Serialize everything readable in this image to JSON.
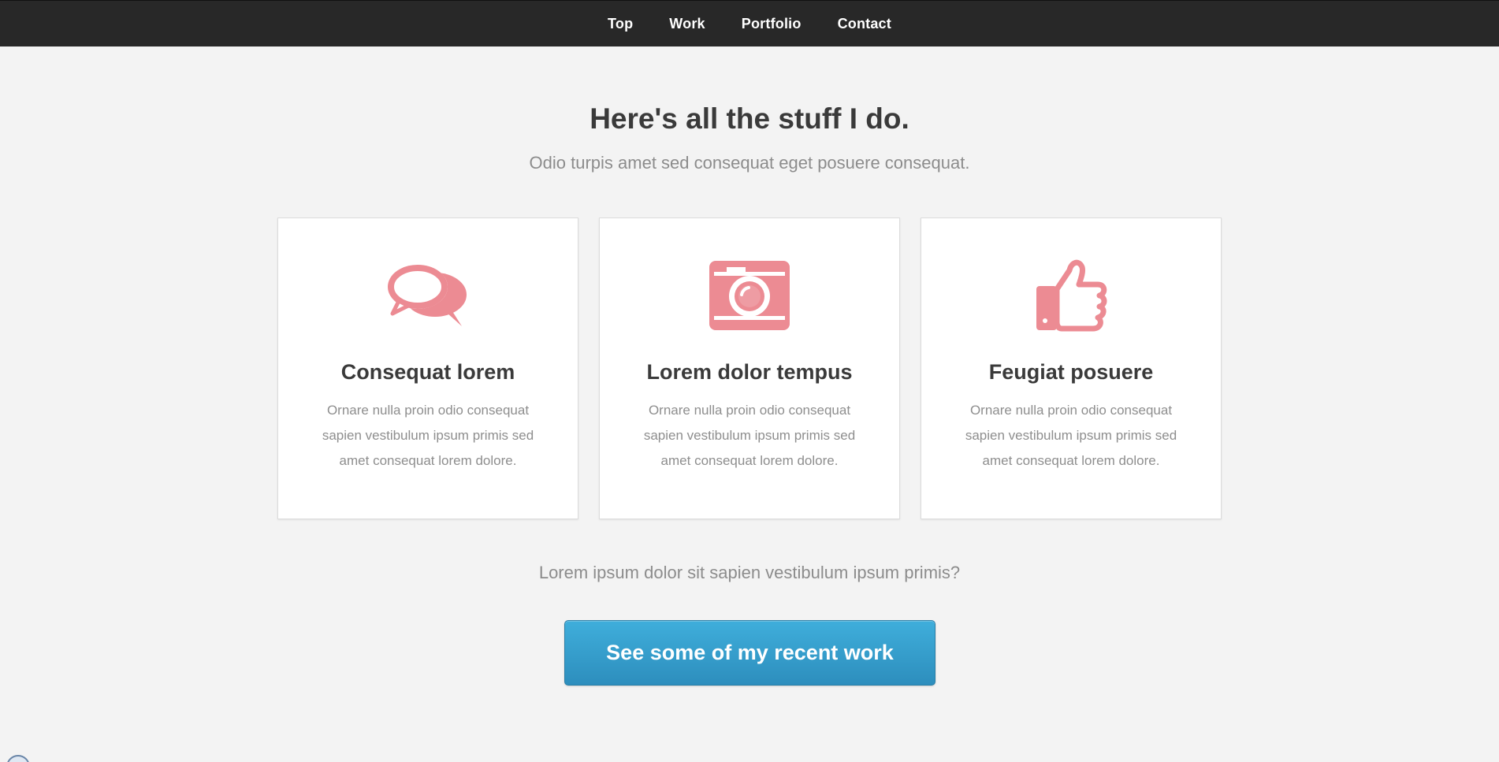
{
  "nav": {
    "items": [
      {
        "label": "Top"
      },
      {
        "label": "Work"
      },
      {
        "label": "Portfolio"
      },
      {
        "label": "Contact"
      }
    ]
  },
  "intro": {
    "title": "Here's all the stuff I do.",
    "subtitle": "Odio turpis amet sed consequat eget posuere consequat."
  },
  "cards": [
    {
      "icon": "speech-bubbles-icon",
      "title": "Consequat lorem",
      "text": "Ornare nulla proin odio consequat sapien vestibulum ipsum primis sed amet consequat lorem dolore."
    },
    {
      "icon": "camera-icon",
      "title": "Lorem dolor tempus",
      "text": "Ornare nulla proin odio consequat sapien vestibulum ipsum primis sed amet consequat lorem dolore."
    },
    {
      "icon": "thumbs-up-icon",
      "title": "Feugiat posuere",
      "text": "Ornare nulla proin odio consequat sapien vestibulum ipsum primis sed amet consequat lorem dolore."
    }
  ],
  "footer_question": "Lorem ipsum dolor sit sapien vestibulum ipsum primis?",
  "cta": {
    "label": "See some of my recent work"
  },
  "colors": {
    "nav_bg": "#282828",
    "icon_pink": "#ec8b93",
    "cta_blue": "#3a9fd0"
  }
}
